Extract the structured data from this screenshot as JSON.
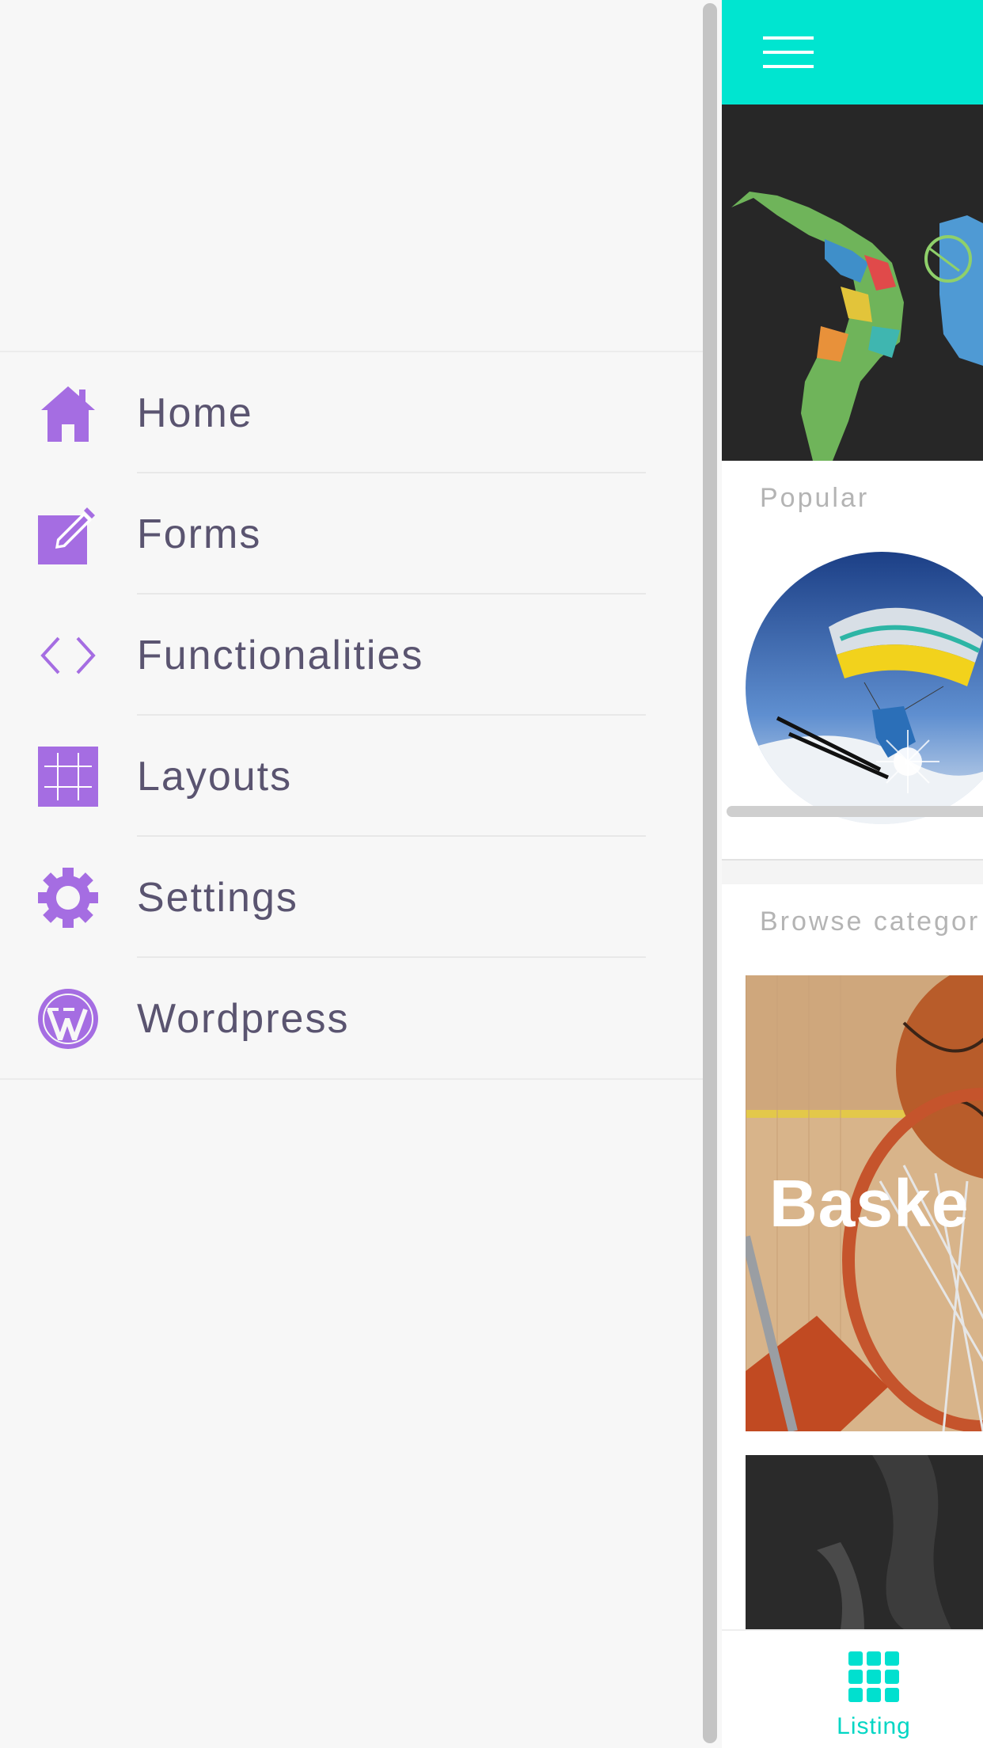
{
  "menu": {
    "items": [
      {
        "label": "Home",
        "icon": "home-icon"
      },
      {
        "label": "Forms",
        "icon": "edit-icon"
      },
      {
        "label": "Functionalities",
        "icon": "code-icon"
      },
      {
        "label": "Layouts",
        "icon": "grid-icon"
      },
      {
        "label": "Settings",
        "icon": "gear-icon"
      },
      {
        "label": "Wordpress",
        "icon": "wordpress-icon"
      }
    ],
    "icon_color": "#a56de2",
    "label_color": "#5a5470"
  },
  "main": {
    "accent_color": "#00e5d0",
    "popular_title": "Popular",
    "browse_title": "Browse categor",
    "categories": [
      {
        "label": "Baske"
      }
    ],
    "bottom_nav": {
      "tabs": [
        {
          "label": "Listing",
          "icon": "grid-icon"
        }
      ]
    }
  }
}
